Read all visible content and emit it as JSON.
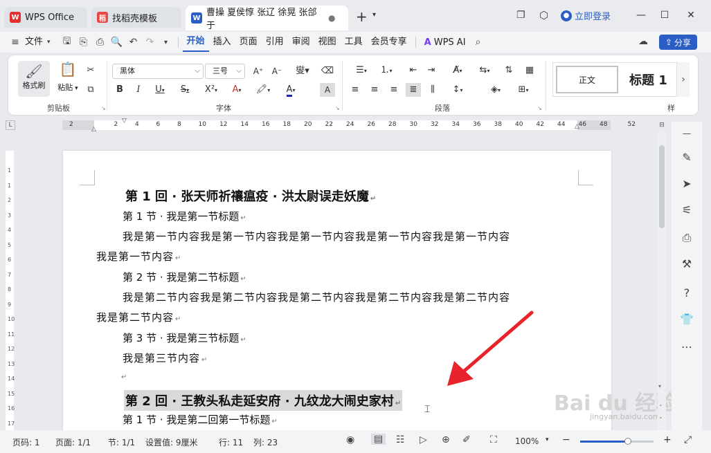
{
  "tabs": [
    {
      "label": "WPS Office",
      "logo": "W",
      "color": "#e03030"
    },
    {
      "label": "找稻壳模板",
      "logo": "稻",
      "color": "#e84848"
    },
    {
      "label": "曹操 夏侯惇 张辽 徐晃 张郃 于",
      "logo": "W",
      "color": "#2a5ec5"
    }
  ],
  "titlebar": {
    "login": "立即登录",
    "new_tab": "+"
  },
  "menu": {
    "file": "文件",
    "items": [
      "开始",
      "插入",
      "页面",
      "引用",
      "审阅",
      "视图",
      "工具",
      "会员专享"
    ],
    "active_index": 0,
    "wps_ai": "WPS AI",
    "share": "分享"
  },
  "ribbon": {
    "format_painter": "格式刷",
    "paste": "粘贴",
    "clipboard_label": "剪贴板",
    "font_name": "黑体",
    "font_size": "三号",
    "font_label": "字体",
    "paragraph_label": "段落",
    "styles": [
      "正文",
      "标题 1"
    ],
    "styles_label": "样"
  },
  "ruler": {
    "ticks": [
      "2",
      "2",
      "4",
      "6",
      "8",
      "10",
      "12",
      "14",
      "16",
      "18",
      "20",
      "22",
      "24",
      "26",
      "28",
      "30",
      "32",
      "34",
      "36",
      "38",
      "40",
      "42",
      "44",
      "46",
      "48",
      "52"
    ]
  },
  "vruler": {
    "ticks": [
      "1",
      "1",
      "2",
      "3",
      "4",
      "5",
      "6",
      "7",
      "8",
      "9",
      "10",
      "11",
      "12",
      "13",
      "14",
      "15",
      "16",
      "17"
    ]
  },
  "document": {
    "heading1": "第 1 回 · 张天师祈禳瘟疫 · 洪太尉误走妖魔",
    "s1_title": "第 1 节 · 我是第一节标题",
    "s1_body_a": "我是第一节内容我是第一节内容我是第一节内容我是第一节内容我是第一节内容",
    "s1_body_b": "我是第一节内容",
    "s2_title": "第 2 节 · 我是第二节标题",
    "s2_body_a": "我是第二节内容我是第二节内容我是第二节内容我是第二节内容我是第二节内容",
    "s2_body_b": "我是第二节内容",
    "s3_title": "第 3 节 · 我是第三节标题",
    "s3_body": "我是第三节内容",
    "heading2": "第 2 回 · 王教头私走延安府 · 九纹龙大闹史家村",
    "c2_s1_title": "第 1 节 · 我是第二回第一节标题",
    "para_mark": "↵"
  },
  "watermark": {
    "brand": "Bai du 经验",
    "url": "jingyan.baidu.com"
  },
  "status": {
    "page": "页码: 1",
    "pages": "页面: 1/1",
    "section": "节: 1/1",
    "setting": "设置值: 9厘米",
    "row": "行: 11",
    "col": "列: 23",
    "zoom": "100%",
    "zoom_level": 0.65
  },
  "colors": {
    "accent": "#2a5ec5",
    "arrow": "#e8232b",
    "highlight": "#d9d9d9"
  }
}
